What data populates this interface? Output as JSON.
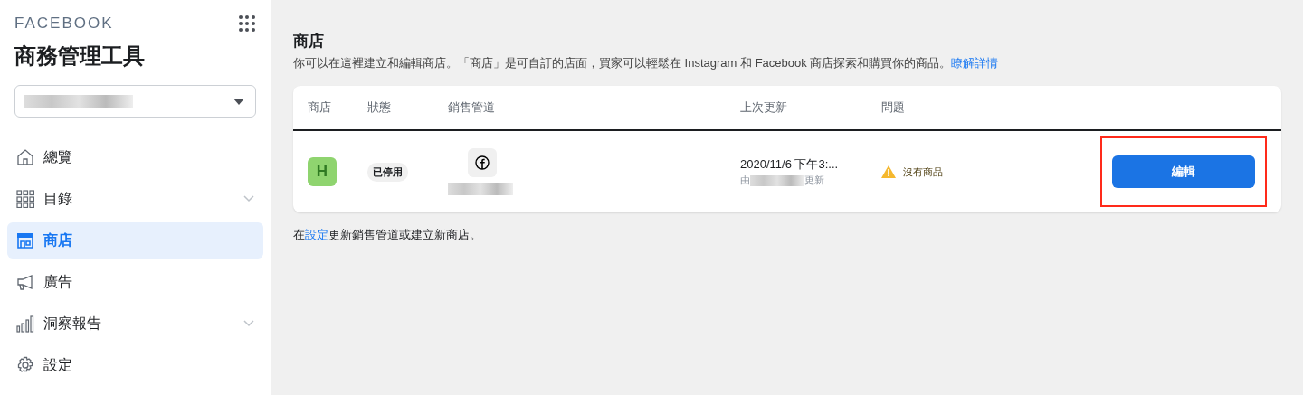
{
  "sidebar": {
    "brand": "FACEBOOK",
    "title": "商務管理工具",
    "items": [
      {
        "label": "總覽",
        "kind": "home",
        "selected": false,
        "has_submenu": false
      },
      {
        "label": "目錄",
        "kind": "grid",
        "selected": false,
        "has_submenu": true
      },
      {
        "label": "商店",
        "kind": "store",
        "selected": true,
        "has_submenu": false
      },
      {
        "label": "廣告",
        "kind": "megaphone",
        "selected": false,
        "has_submenu": false
      },
      {
        "label": "洞察報告",
        "kind": "chart",
        "selected": false,
        "has_submenu": true
      },
      {
        "label": "設定",
        "kind": "gear",
        "selected": false,
        "has_submenu": false
      }
    ]
  },
  "main": {
    "title": "商店",
    "description": "你可以在這裡建立和編輯商店。「商店」是可自訂的店面，買家可以輕鬆在 Instagram 和 Facebook 商店探索和購買你的商品。",
    "learn_more_link": "瞭解詳情",
    "table": {
      "columns": [
        "商店",
        "狀態",
        "銷售管道",
        "上次更新",
        "問題"
      ],
      "rows": [
        {
          "shop_initial": "H",
          "status": "已停用",
          "updated": "2020/11/6 下午3:...",
          "updated_by_prefix": "由",
          "updated_by_suffix": "更新",
          "issue": "沒有商品",
          "action": "編輯",
          "highlighted": true
        }
      ]
    },
    "footer": {
      "prefix": "在",
      "link": "設定",
      "suffix": "更新銷售管道或建立新商店。"
    }
  }
}
